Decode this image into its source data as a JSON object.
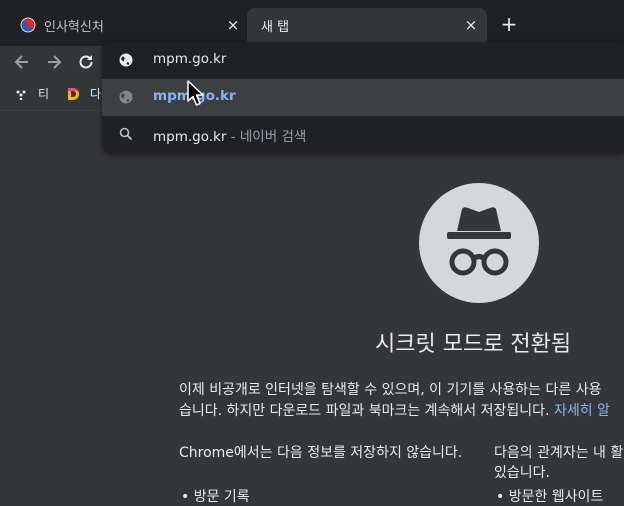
{
  "tabs": [
    {
      "title": "인사혁신처",
      "close": "×",
      "active": false
    },
    {
      "title": "새 탭",
      "close": "×",
      "active": true
    }
  ],
  "new_tab_label": "+",
  "bookmarks": [
    {
      "label": "티"
    },
    {
      "label": "다"
    }
  ],
  "omnibox": {
    "input_value": "mpm.go.kr",
    "suggestions": [
      {
        "type": "url",
        "text": "mpm.go.kr"
      },
      {
        "type": "search",
        "text": "mpm.go.kr",
        "separator": " - ",
        "engine": "네이버 검색"
      }
    ]
  },
  "incognito": {
    "heading": "시크릿 모드로 전환됨",
    "paragraph_line1": "이제 비공개로 인터넷을 탐색할 수 있으며, 이 기기를 사용하는 다른 사용",
    "paragraph_line2": "습니다. 하지만 다운로드 파일과 북마크는 계속해서 저장됩니다. ",
    "learn_more": "자세히 알",
    "col1_text": "Chrome에서는 다음 정보를 저장하지 않습니다.",
    "col2_line1": "다음의 관계자는 내 활",
    "col2_line2": "있습니다.",
    "col1_bullet": "• 방문 기록",
    "col2_bullet": "• 방문한 웹사이트"
  },
  "colors": {
    "background": "#35363a",
    "tabstrip": "#202124",
    "link": "#8ab4f8",
    "incognito_circle": "#d6d7d9"
  }
}
